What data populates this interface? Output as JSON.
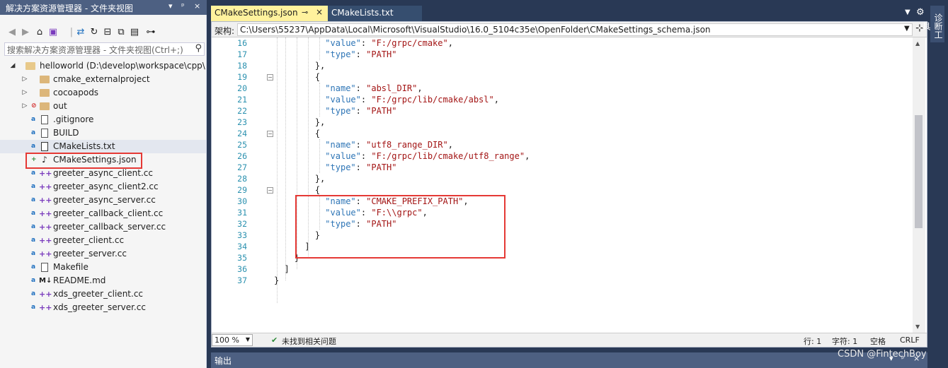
{
  "solution_explorer": {
    "title": "解决方案资源管理器 - 文件夹视图",
    "title_controls": [
      "▾",
      "ᵖ",
      "×"
    ],
    "search_placeholder": "搜索解决方案资源管理器 - 文件夹视图(Ctrl+;)",
    "tree": [
      {
        "label": "helloworld (D:\\develop\\workspace\\cpp\\",
        "kind": "root"
      },
      {
        "label": "cmake_externalproject",
        "kind": "folder"
      },
      {
        "label": "cocoapods",
        "kind": "folder"
      },
      {
        "label": "out",
        "kind": "folder",
        "status": "excluded"
      },
      {
        "label": ".gitignore",
        "kind": "file"
      },
      {
        "label": "BUILD",
        "kind": "file"
      },
      {
        "label": "CMakeLists.txt",
        "kind": "file",
        "selected": true
      },
      {
        "label": "CMakeSettings.json",
        "kind": "json",
        "status": "added",
        "highlighted": true
      },
      {
        "label": "greeter_async_client.cc",
        "kind": "cpp"
      },
      {
        "label": "greeter_async_client2.cc",
        "kind": "cpp"
      },
      {
        "label": "greeter_async_server.cc",
        "kind": "cpp"
      },
      {
        "label": "greeter_callback_client.cc",
        "kind": "cpp"
      },
      {
        "label": "greeter_callback_server.cc",
        "kind": "cpp"
      },
      {
        "label": "greeter_client.cc",
        "kind": "cpp"
      },
      {
        "label": "greeter_server.cc",
        "kind": "cpp"
      },
      {
        "label": "Makefile",
        "kind": "file"
      },
      {
        "label": "README.md",
        "kind": "md"
      },
      {
        "label": "xds_greeter_client.cc",
        "kind": "cpp"
      },
      {
        "label": "xds_greeter_server.cc",
        "kind": "cpp"
      }
    ]
  },
  "tabs": [
    {
      "label": "CMakeSettings.json",
      "pin": "⊸",
      "close": "×",
      "active": true
    },
    {
      "label": "CMakeLists.txt",
      "active": false
    }
  ],
  "navbar": {
    "label": "架构:",
    "path": "C:\\Users\\55237\\AppData\\Local\\Microsoft\\VisualStudio\\16.0_5104c35e\\OpenFolder\\CMakeSettings_schema.json"
  },
  "code_lines": [
    {
      "n": "16",
      "text": "\"value\": \"F:/grpc/cmake\","
    },
    {
      "n": "17",
      "text": "\"type\": \"PATH\""
    },
    {
      "n": "18",
      "text": "},"
    },
    {
      "n": "19",
      "text": "{"
    },
    {
      "n": "20",
      "text": "\"name\": \"absl_DIR\","
    },
    {
      "n": "21",
      "text": "\"value\": \"F:/grpc/lib/cmake/absl\","
    },
    {
      "n": "22",
      "text": "\"type\": \"PATH\""
    },
    {
      "n": "23",
      "text": "},"
    },
    {
      "n": "24",
      "text": "{"
    },
    {
      "n": "25",
      "text": "\"name\": \"utf8_range_DIR\","
    },
    {
      "n": "26",
      "text": "\"value\": \"F:/grpc/lib/cmake/utf8_range\","
    },
    {
      "n": "27",
      "text": "\"type\": \"PATH\""
    },
    {
      "n": "28",
      "text": "},"
    },
    {
      "n": "29",
      "text": "{"
    },
    {
      "n": "30",
      "text": "\"name\": \"CMAKE_PREFIX_PATH\","
    },
    {
      "n": "31",
      "text": "\"value\": \"F:\\\\grpc\","
    },
    {
      "n": "32",
      "text": "\"type\": \"PATH\""
    },
    {
      "n": "33",
      "text": "}"
    },
    {
      "n": "34",
      "text": "]"
    },
    {
      "n": "35",
      "text": "}"
    },
    {
      "n": "36",
      "text": "]"
    },
    {
      "n": "37",
      "text": "}"
    }
  ],
  "status": {
    "zoom": "100 %",
    "issues": "未找到相关问题",
    "line": "行: 1",
    "char": "字符: 1",
    "whitespace": "空格",
    "eol": "CRLF"
  },
  "diagnostics_tab": "诊断工具",
  "output_panel": {
    "title": "输出",
    "controls": [
      "▾",
      "ᵖ",
      "×"
    ]
  },
  "watermark": "CSDN @FintechBoy",
  "colors": {
    "title_bar": "#4d6082",
    "active_tab": "#fff29d",
    "highlight_box": "#e53935",
    "json_key": "#2e75b6",
    "json_string": "#a31515",
    "line_number": "#2b91af"
  }
}
